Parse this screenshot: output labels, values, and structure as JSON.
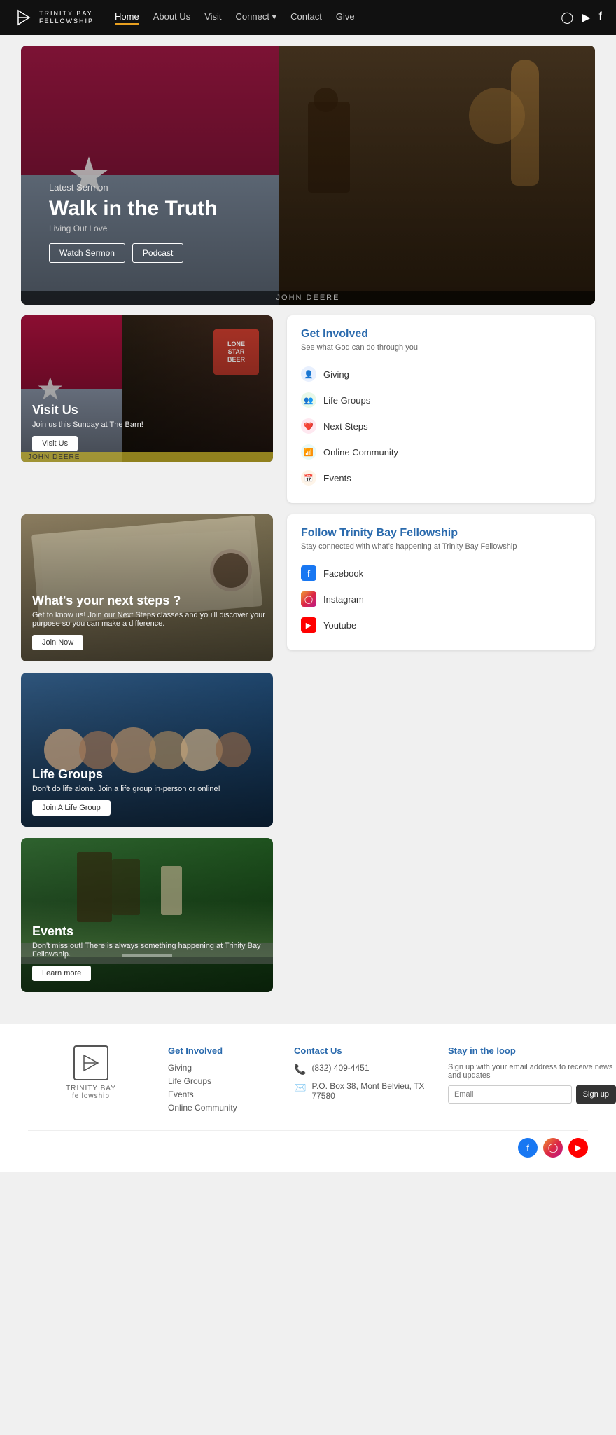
{
  "nav": {
    "logo_line1": "TRINITY BAY",
    "logo_line2": "fellowship",
    "links": [
      {
        "label": "Home",
        "active": true
      },
      {
        "label": "About Us",
        "active": false
      },
      {
        "label": "Visit",
        "active": false
      },
      {
        "label": "Connect ▾",
        "active": false
      },
      {
        "label": "Contact",
        "active": false
      },
      {
        "label": "Give",
        "active": false
      }
    ],
    "social": [
      "instagram",
      "youtube",
      "facebook"
    ]
  },
  "hero": {
    "label": "Latest Sermon",
    "title": "Walk in the Truth",
    "subtitle": "Living Out Love",
    "btn_watch": "Watch Sermon",
    "btn_podcast": "Podcast",
    "bottom_bar": "JOHN DEERE"
  },
  "section_visit": {
    "title": "Visit Us",
    "desc": "Join us this Sunday at The Barn!",
    "btn": "Visit Us",
    "bottom_bar": "JOHN DEERE"
  },
  "get_involved": {
    "title": "Get Involved",
    "subtitle": "See what God can do through you",
    "items": [
      {
        "icon": "👤",
        "label": "Giving"
      },
      {
        "icon": "👥",
        "label": "Life Groups"
      },
      {
        "icon": "❤️",
        "label": "Next Steps"
      },
      {
        "icon": "📶",
        "label": "Online Community"
      },
      {
        "icon": "📅",
        "label": "Events"
      }
    ]
  },
  "section_nextsteps": {
    "title": "What's your next steps ?",
    "desc": "Get to know us! Join our Next Steps classes and you'll discover your purpose so you can make a difference.",
    "btn": "Join Now"
  },
  "follow": {
    "title": "Follow Trinity Bay Fellowship",
    "subtitle": "Stay connected with what's happening at Trinity Bay Fellowship",
    "items": [
      {
        "platform": "Facebook",
        "type": "facebook"
      },
      {
        "platform": "Instagram",
        "type": "instagram"
      },
      {
        "platform": "Youtube",
        "type": "youtube"
      }
    ]
  },
  "section_lifegroups": {
    "title": "Life Groups",
    "desc": "Don't do life alone. Join a life group in-person or online!",
    "btn": "Join A Life Group"
  },
  "section_events": {
    "title": "Events",
    "desc": "Don't miss out! There is always something happening at Trinity Bay Fellowship.",
    "btn": "Learn more"
  },
  "footer": {
    "logo_line1": "TRINITY BAY",
    "logo_line2": "fellowship",
    "get_involved": {
      "heading": "Get Involved",
      "links": [
        "Giving",
        "Life Groups",
        "Events",
        "Online Community"
      ]
    },
    "contact": {
      "heading": "Contact Us",
      "phone": "(832) 409-4451",
      "address": "P.O. Box 38, Mont Belvieu, TX 77580"
    },
    "newsletter": {
      "heading": "Stay in the loop",
      "desc": "Sign up with your email address to receive news and updates",
      "placeholder": "Email",
      "btn": "Sign up"
    }
  }
}
